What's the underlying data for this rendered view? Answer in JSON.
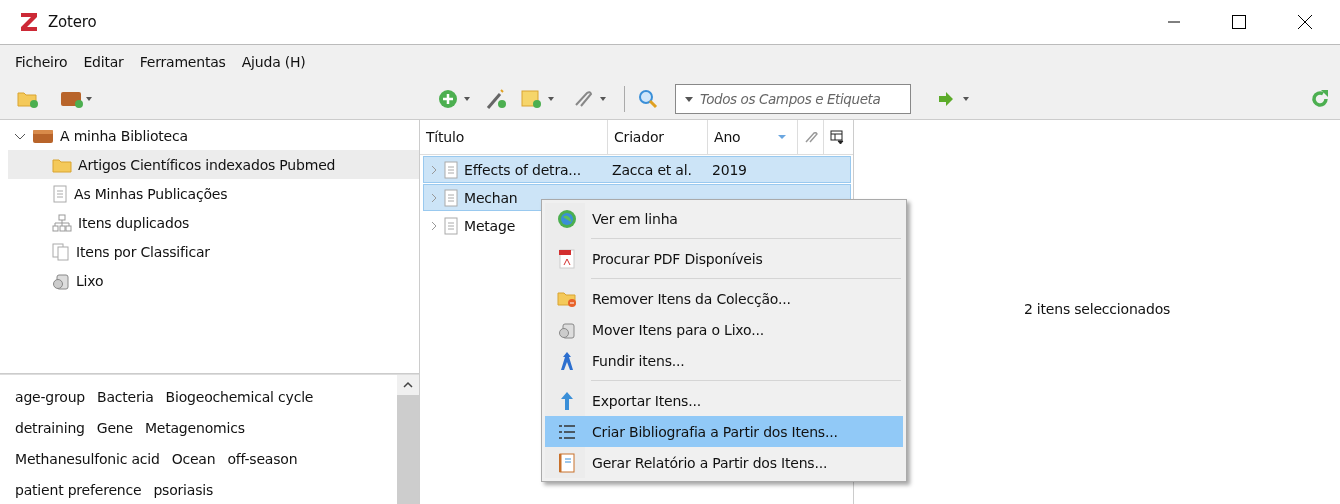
{
  "window": {
    "title": "Zotero"
  },
  "menubar": [
    "Ficheiro",
    "Editar",
    "Ferramentas",
    "Ajuda (H)"
  ],
  "search": {
    "placeholder": "Todos os Campos e Etiqueta"
  },
  "collections": [
    {
      "label": "A minha Biblioteca",
      "kind": "library",
      "expanded": true,
      "selected": false,
      "children": [
        {
          "label": "Artigos Científicos indexados Pubmed",
          "kind": "folder",
          "selected": true
        },
        {
          "label": "As Minhas Publicações",
          "kind": "document",
          "selected": false
        },
        {
          "label": "Itens duplicados",
          "kind": "duplicates",
          "selected": false
        },
        {
          "label": "Itens por Classificar",
          "kind": "unfiled",
          "selected": false
        },
        {
          "label": "Lixo",
          "kind": "trash",
          "selected": false
        }
      ]
    }
  ],
  "tags": [
    [
      "age-group",
      "Bacteria",
      "Biogeochemical cycle"
    ],
    [
      "detraining",
      "Gene",
      "Metagenomics"
    ],
    [
      "Methanesulfonic acid",
      "Ocean",
      "off-season"
    ],
    [
      "patient preference",
      "psoriasis"
    ]
  ],
  "table": {
    "columns": [
      "Título",
      "Criador",
      "Ano"
    ],
    "rows": [
      {
        "title": "Effects of detra...",
        "creator": "Zacca et al.",
        "year": "2019",
        "selected": true
      },
      {
        "title": "Mechan",
        "selected": true
      },
      {
        "title": "Metage",
        "selected": false
      }
    ]
  },
  "context_menu": [
    {
      "label": "Ver em linha",
      "kind": "globe",
      "selected": false
    },
    {
      "kind": "separator"
    },
    {
      "label": "Procurar PDF Disponíveis",
      "kind": "pdf",
      "selected": false
    },
    {
      "kind": "separator"
    },
    {
      "label": "Remover Itens da Colecção...",
      "kind": "folder-remove",
      "selected": false
    },
    {
      "label": "Mover Itens para o Lixo...",
      "kind": "trash",
      "selected": false
    },
    {
      "label": "Fundir itens...",
      "kind": "merge",
      "selected": false
    },
    {
      "kind": "separator"
    },
    {
      "label": "Exportar Itens...",
      "kind": "export",
      "selected": false
    },
    {
      "label": "Criar Bibliografia a Partir dos Itens...",
      "kind": "list",
      "selected": true
    },
    {
      "label": "Gerar Relatório a Partir dos Itens...",
      "kind": "report",
      "selected": false
    }
  ],
  "item_pane": {
    "message": "2 itens seleccionados"
  }
}
